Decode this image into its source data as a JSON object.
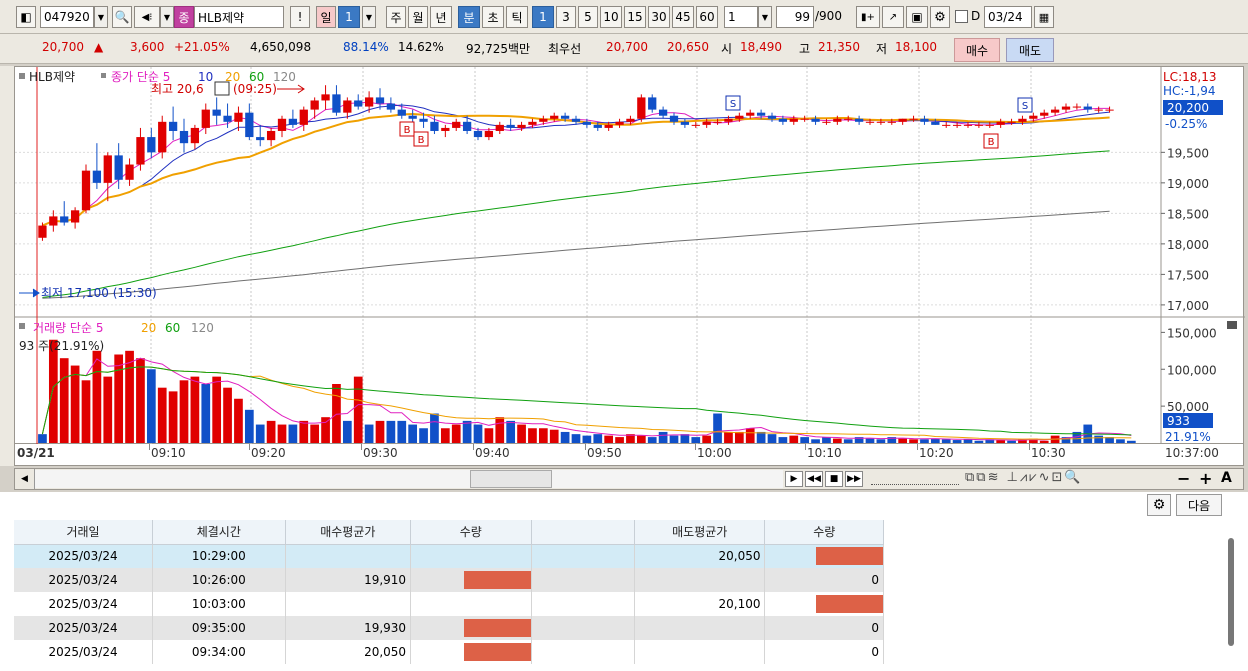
{
  "toolbar": {
    "code": "047920",
    "stock_tag": "종",
    "stock_name": "HLB제약",
    "exclaim": "!",
    "period_day": "일",
    "period_num": "1",
    "period_week": "주",
    "period_month": "월",
    "period_year": "년",
    "period_min": "분",
    "period_sec": "초",
    "period_tick": "틱",
    "intervals": [
      "1",
      "3",
      "5",
      "10",
      "15",
      "30",
      "45",
      "60"
    ],
    "interval_value": "1",
    "count": "99",
    "count_max": "/900",
    "date_prefix": "D",
    "date": "03/24"
  },
  "quote": {
    "price": "20,700",
    "arrow": "▲",
    "change": "3,600",
    "rate": "+21.05%",
    "volume": "4,650,098",
    "ratio1": "88.14%",
    "ratio2": "14.62%",
    "amount": "92,725백만",
    "best_label": "최우선",
    "best_ask": "20,700",
    "best_bid": "20,650",
    "open_label": "시",
    "open": "18,490",
    "high_label": "고",
    "high": "21,350",
    "low_label": "저",
    "low": "18,100",
    "buy_label": "매수",
    "sell_label": "매도"
  },
  "chart_data": [
    {
      "type": "candlestick",
      "title": "HLB제약",
      "legend": [
        "종가 단순 5",
        "10",
        "20",
        "60",
        "120"
      ],
      "colors": {
        "ma5": "#e020c0",
        "ma10": "#2030c0",
        "ma20": "#f0a000",
        "ma60": "#10a010",
        "ma120": "#707070",
        "up": "#e00000",
        "down": "#1050c8"
      },
      "annotations": {
        "high": "최고 20,6",
        "high_time": "(09:25)",
        "low": "최저 17,100 (15:30)",
        "lc": "LC:18,13",
        "hc": "HC:-1,94"
      },
      "price_labels": [
        "19,500",
        "19,000",
        "18,500",
        "18,000",
        "17,500",
        "17,000"
      ],
      "current_price": "20,200",
      "current_rate": "-0.25%",
      "ylim": [
        16900,
        20800
      ],
      "x_labels": [
        "03/21",
        "09:10",
        "09:20",
        "09:30",
        "09:40",
        "09:50",
        "10:00",
        "10:10",
        "10:20",
        "10:30",
        "10:37:00"
      ],
      "candles": [
        [
          18100,
          18350,
          18050,
          18300
        ],
        [
          18300,
          18550,
          18200,
          18450
        ],
        [
          18450,
          18700,
          18300,
          18350
        ],
        [
          18350,
          18600,
          18250,
          18550
        ],
        [
          18550,
          19300,
          18500,
          19200
        ],
        [
          19200,
          19650,
          18900,
          19000
        ],
        [
          19000,
          19500,
          18700,
          19450
        ],
        [
          19450,
          19650,
          18900,
          19050
        ],
        [
          19050,
          19400,
          18950,
          19300
        ],
        [
          19300,
          19900,
          19200,
          19750
        ],
        [
          19750,
          19900,
          19400,
          19500
        ],
        [
          19500,
          20100,
          19400,
          20000
        ],
        [
          20000,
          20250,
          19700,
          19850
        ],
        [
          19850,
          20050,
          19500,
          19650
        ],
        [
          19650,
          19950,
          19550,
          19900
        ],
        [
          19900,
          20300,
          19800,
          20200
        ],
        [
          20200,
          20400,
          19950,
          20100
        ],
        [
          20100,
          20300,
          19900,
          20000
        ],
        [
          20000,
          20250,
          19850,
          20150
        ],
        [
          20150,
          20300,
          19700,
          19750
        ],
        [
          19750,
          19950,
          19600,
          19700
        ],
        [
          19700,
          19900,
          19600,
          19850
        ],
        [
          19850,
          20100,
          19750,
          20050
        ],
        [
          20050,
          20200,
          19900,
          19950
        ],
        [
          19950,
          20250,
          19850,
          20200
        ],
        [
          20200,
          20400,
          20050,
          20350
        ],
        [
          20350,
          20600,
          20200,
          20450
        ],
        [
          20450,
          20600,
          20100,
          20150
        ],
        [
          20150,
          20400,
          20050,
          20350
        ],
        [
          20350,
          20450,
          20200,
          20250
        ],
        [
          20250,
          20500,
          20150,
          20400
        ],
        [
          20400,
          20550,
          20200,
          20300
        ],
        [
          20300,
          20400,
          20150,
          20200
        ],
        [
          20200,
          20300,
          20050,
          20100
        ],
        [
          20100,
          20200,
          19950,
          20050
        ],
        [
          20050,
          20150,
          19900,
          20000
        ],
        [
          20000,
          20100,
          19800,
          19850
        ],
        [
          19850,
          19950,
          19750,
          19900
        ],
        [
          19900,
          20050,
          19850,
          20000
        ],
        [
          20000,
          20100,
          19800,
          19850
        ],
        [
          19850,
          19900,
          19700,
          19750
        ],
        [
          19750,
          19900,
          19700,
          19850
        ],
        [
          19850,
          20000,
          19800,
          19950
        ],
        [
          19950,
          20050,
          19850,
          19900
        ],
        [
          19900,
          20000,
          19850,
          19950
        ],
        [
          19950,
          20050,
          19900,
          20000
        ],
        [
          20000,
          20100,
          19950,
          20050
        ],
        [
          20050,
          20150,
          20000,
          20100
        ],
        [
          20100,
          20150,
          20000,
          20050
        ],
        [
          20050,
          20100,
          19950,
          20000
        ],
        [
          20000,
          20050,
          19900,
          19950
        ],
        [
          19950,
          20000,
          19850,
          19900
        ],
        [
          19900,
          20000,
          19850,
          19950
        ],
        [
          19950,
          20050,
          19900,
          20000
        ],
        [
          20000,
          20100,
          19950,
          20050
        ],
        [
          20050,
          20450,
          20000,
          20400
        ],
        [
          20400,
          20450,
          20150,
          20200
        ],
        [
          20200,
          20250,
          20050,
          20100
        ],
        [
          20100,
          20150,
          19950,
          20000
        ],
        [
          20000,
          20050,
          19900,
          19950
        ],
        [
          19950,
          20000,
          19900,
          19950
        ],
        [
          19950,
          20050,
          19900,
          20000
        ],
        [
          20000,
          20050,
          19950,
          20000
        ],
        [
          20000,
          20100,
          19950,
          20050
        ],
        [
          20050,
          20150,
          20000,
          20100
        ],
        [
          20100,
          20200,
          20050,
          20150
        ],
        [
          20150,
          20200,
          20050,
          20100
        ],
        [
          20100,
          20150,
          20000,
          20050
        ],
        [
          20050,
          20100,
          19950,
          20000
        ],
        [
          20000,
          20100,
          19950,
          20050
        ],
        [
          20050,
          20100,
          20000,
          20050
        ],
        [
          20050,
          20100,
          19950,
          20000
        ],
        [
          20000,
          20050,
          19950,
          20000
        ],
        [
          20000,
          20100,
          19950,
          20050
        ],
        [
          20050,
          20100,
          20000,
          20050
        ],
        [
          20050,
          20100,
          19950,
          20000
        ],
        [
          20000,
          20050,
          19950,
          20000
        ],
        [
          20000,
          20050,
          19950,
          20000
        ],
        [
          20000,
          20050,
          19950,
          20000
        ],
        [
          20000,
          20050,
          19950,
          20050
        ],
        [
          20050,
          20100,
          20000,
          20050
        ],
        [
          20050,
          20100,
          19950,
          20000
        ],
        [
          20000,
          20050,
          19950,
          19950
        ],
        [
          19950,
          20000,
          19900,
          19950
        ],
        [
          19950,
          20000,
          19900,
          19950
        ],
        [
          19950,
          20000,
          19900,
          19950
        ],
        [
          19950,
          20000,
          19900,
          19950
        ],
        [
          19950,
          20000,
          19900,
          19950
        ],
        [
          19950,
          20050,
          19900,
          20000
        ],
        [
          20000,
          20050,
          19950,
          20000
        ],
        [
          20000,
          20100,
          19950,
          20050
        ],
        [
          20050,
          20150,
          20000,
          20100
        ],
        [
          20100,
          20200,
          20050,
          20150
        ],
        [
          20150,
          20250,
          20100,
          20200
        ],
        [
          20200,
          20300,
          20150,
          20250
        ],
        [
          20250,
          20300,
          20200,
          20250
        ],
        [
          20250,
          20300,
          20150,
          20200
        ],
        [
          20200,
          20250,
          20150,
          20200
        ],
        [
          20200,
          20250,
          20150,
          20200
        ]
      ]
    },
    {
      "type": "bar",
      "title": "거래량",
      "legend": [
        "거래량 단순 5",
        "20",
        "60",
        "120"
      ],
      "info": "93 주(21.91%)",
      "y_labels": [
        "150,000",
        "100,000",
        "50,000"
      ],
      "current_volume": "933",
      "current_rate": "21.91%",
      "ylim": [
        0,
        160000
      ],
      "values": [
        12000,
        140000,
        115000,
        105000,
        85000,
        125000,
        90000,
        120000,
        125000,
        115000,
        100000,
        75000,
        70000,
        85000,
        90000,
        80000,
        90000,
        75000,
        60000,
        45000,
        25000,
        30000,
        25000,
        25000,
        30000,
        25000,
        35000,
        80000,
        30000,
        90000,
        25000,
        30000,
        30000,
        30000,
        25000,
        20000,
        40000,
        20000,
        25000,
        30000,
        25000,
        20000,
        35000,
        30000,
        25000,
        20000,
        20000,
        18000,
        15000,
        12000,
        10000,
        12000,
        10000,
        8000,
        12000,
        10000,
        8000,
        15000,
        10000,
        12000,
        8000,
        10000,
        40000,
        15000,
        15000,
        20000,
        15000,
        12000,
        8000,
        10000,
        8000,
        5000,
        8000,
        6000,
        5000,
        8000,
        6000,
        5000,
        8000,
        6000,
        5000,
        5000,
        6000,
        5000,
        4000,
        5000,
        3000,
        5000,
        4000,
        3000,
        5000,
        6000,
        3000,
        10000,
        8000,
        15000,
        25000,
        10000,
        8000,
        5000,
        3000
      ],
      "up_flags": [
        0,
        1,
        1,
        1,
        1,
        1,
        1,
        1,
        1,
        1,
        0,
        1,
        1,
        1,
        1,
        0,
        1,
        1,
        1,
        0,
        0,
        1,
        1,
        0,
        1,
        1,
        1,
        1,
        0,
        1,
        0,
        1,
        0,
        0,
        0,
        0,
        0,
        1,
        1,
        0,
        0,
        1,
        1,
        0,
        1,
        1,
        1,
        1,
        0,
        0,
        0,
        0,
        1,
        1,
        1,
        1,
        0,
        0,
        0,
        0,
        0,
        1,
        0,
        1,
        1,
        1,
        0,
        0,
        0,
        1,
        0,
        0,
        0,
        1,
        0,
        0,
        0,
        0,
        0,
        1,
        1,
        0,
        0,
        0,
        0,
        0,
        0,
        0,
        1,
        0,
        1,
        1,
        1,
        1,
        0,
        0,
        0,
        0,
        0,
        0,
        0
      ]
    }
  ],
  "scroll_controls": {
    "next_label": "다음"
  },
  "table": {
    "headers": [
      "거래일",
      "체결시간",
      "매수평균가",
      "수량",
      "",
      "매도평균가",
      "수량"
    ],
    "rows": [
      {
        "date": "2025/03/24",
        "time": "10:29:00",
        "buy_avg": "",
        "buy_bar": false,
        "sell_avg": "20,050",
        "sell_qty": "",
        "sell_bar": true
      },
      {
        "date": "2025/03/24",
        "time": "10:26:00",
        "buy_avg": "19,910",
        "buy_bar": true,
        "sell_avg": "",
        "sell_qty": "0",
        "sell_bar": false
      },
      {
        "date": "2025/03/24",
        "time": "10:03:00",
        "buy_avg": "",
        "buy_bar": false,
        "sell_avg": "20,100",
        "sell_qty": "",
        "sell_bar": true
      },
      {
        "date": "2025/03/24",
        "time": "09:35:00",
        "buy_avg": "19,930",
        "buy_bar": true,
        "sell_avg": "",
        "sell_qty": "0",
        "sell_bar": false
      },
      {
        "date": "2025/03/24",
        "time": "09:34:00",
        "buy_avg": "20,050",
        "buy_bar": true,
        "sell_avg": "",
        "sell_qty": "0",
        "sell_bar": false
      }
    ]
  }
}
